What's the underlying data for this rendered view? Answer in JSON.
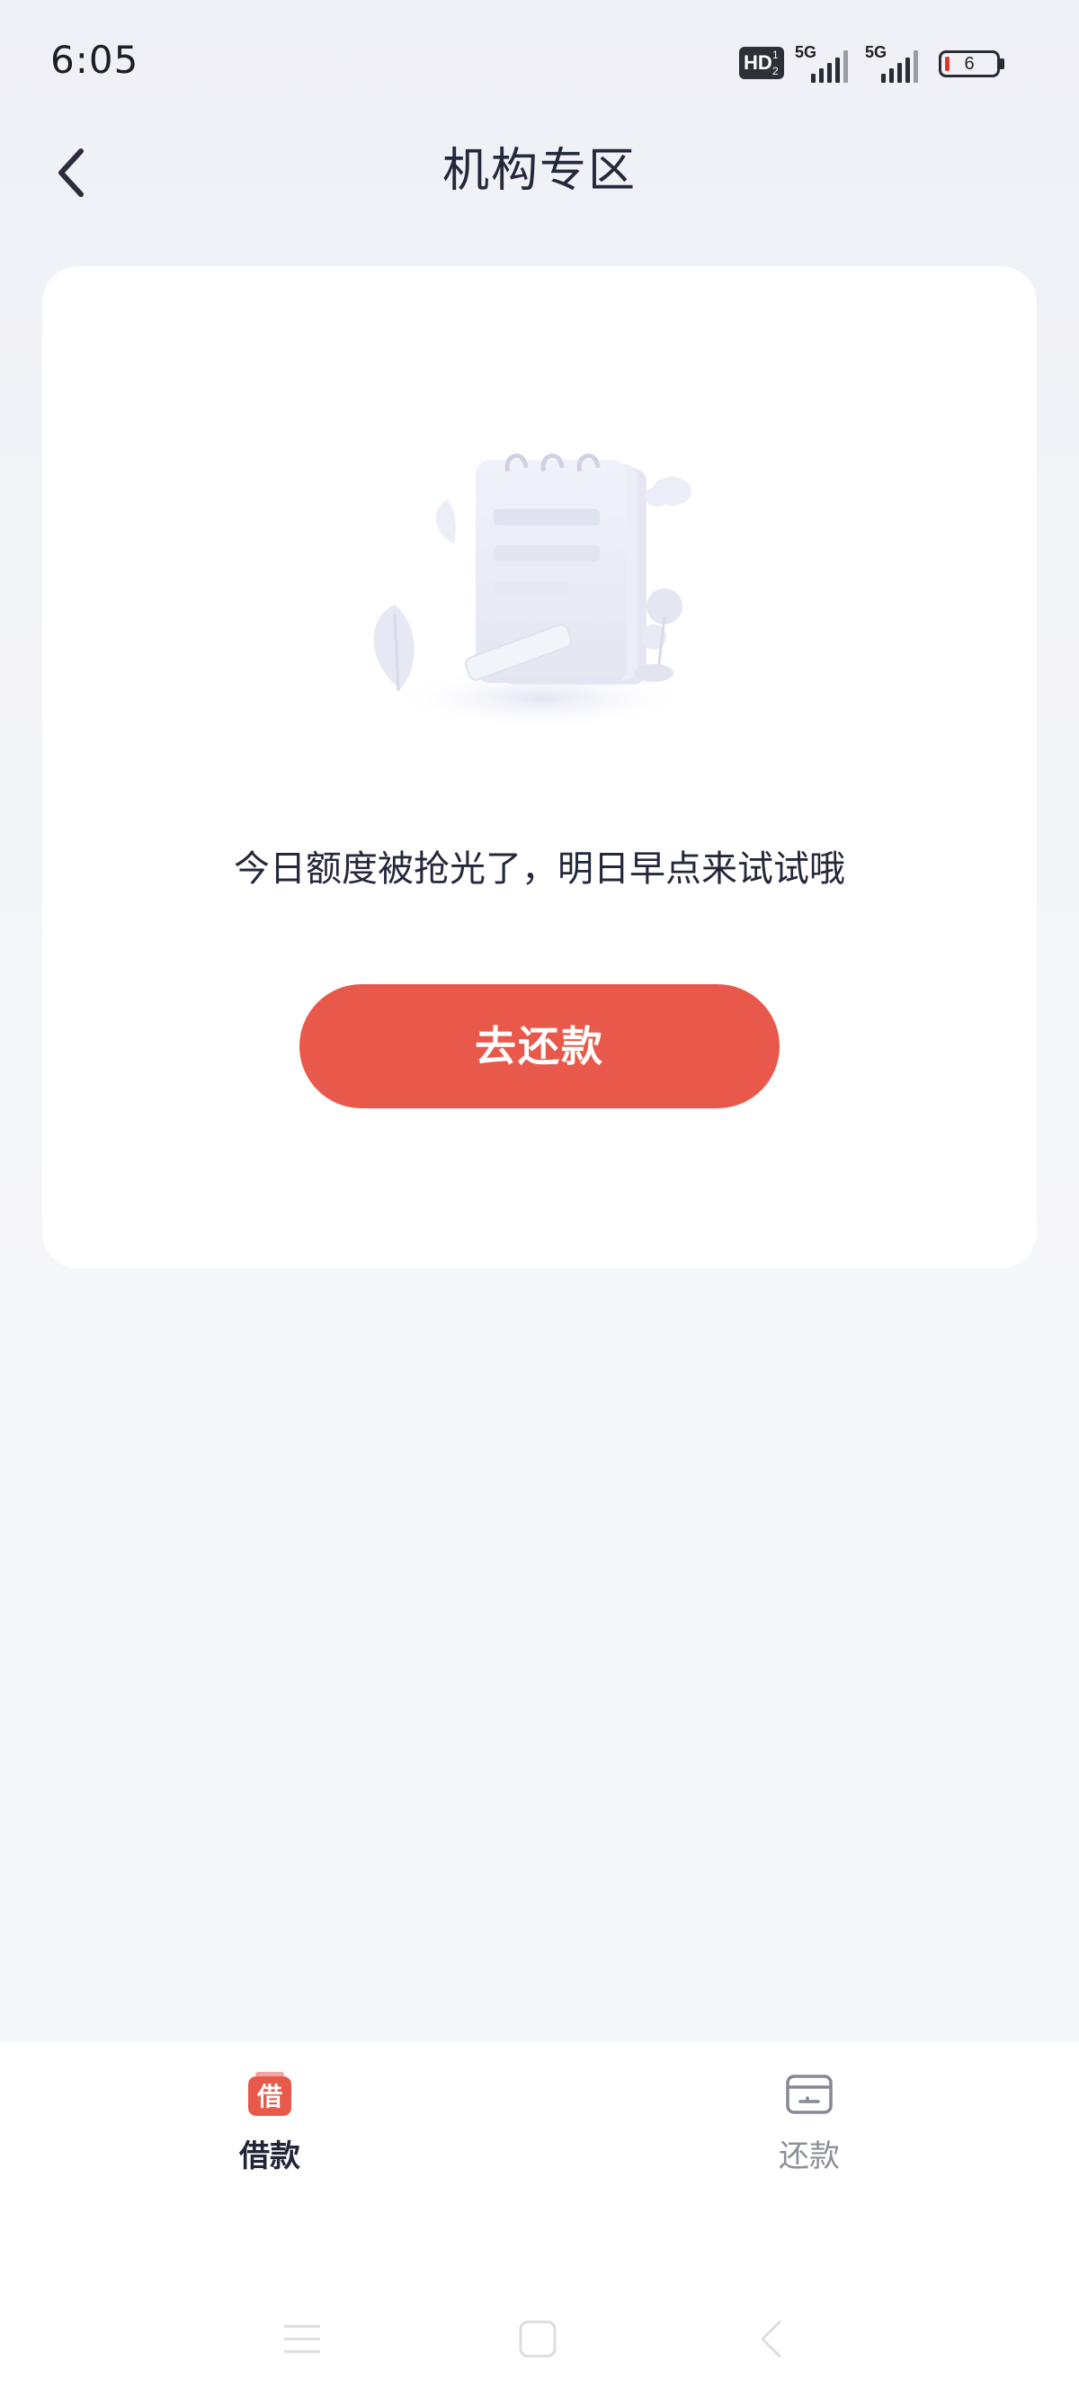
{
  "status_bar": {
    "time": "6:05",
    "hd_label": "HD",
    "hd_sub": "1 2",
    "network_1": "5G",
    "network_2": "5G",
    "battery_level": "6"
  },
  "header": {
    "title": "机构专区",
    "back_icon": "chevron-left-icon"
  },
  "empty_state": {
    "illustration": "notebook-illustration",
    "message": "今日额度被抢光了，明日早点来试试哦",
    "button_label": "去还款"
  },
  "tabs": [
    {
      "label": "借款",
      "icon": "borrow-icon",
      "icon_text": "借",
      "active": true,
      "color": "#222638"
    },
    {
      "label": "还款",
      "icon": "wallet-icon",
      "active": false,
      "color": "#8c8f99"
    }
  ],
  "colors": {
    "accent": "#e8594b",
    "text_primary": "#222638",
    "tab_inactive": "#8c8f99",
    "background": "#f6f7fa"
  },
  "system_nav": [
    "menu-icon",
    "home-icon",
    "back-icon"
  ]
}
